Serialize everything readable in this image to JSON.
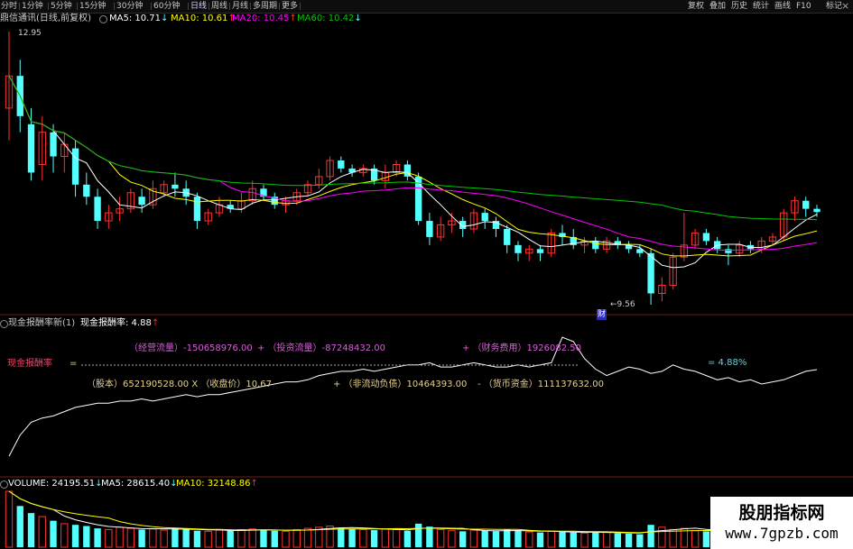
{
  "toolbar": {
    "periods": [
      "分时",
      "1分钟",
      "5分钟",
      "15分钟",
      "30分钟",
      "60分钟",
      "日线",
      "周线",
      "月线",
      "多周期",
      "更多"
    ],
    "active_period": "日线",
    "right_buttons": [
      "复权",
      "叠加",
      "历史",
      "统计",
      "画线",
      "F10",
      "标记"
    ],
    "close_icon": "×"
  },
  "header": {
    "stock": "鼎信通讯(日线,前复权)",
    "ma5": "MA5: 10.71",
    "ma5_arrow": "↓",
    "ma10": "MA10: 10.61",
    "ma10_arrow": "↑",
    "ma20": "MA20: 10.45",
    "ma20_arrow": "↑",
    "ma60": "MA60: 10.42",
    "ma60_arrow": "↓"
  },
  "price_labels": {
    "high": "12.95",
    "low": "9.56",
    "badge": "财"
  },
  "indicator": {
    "title": "现金报酬率新(1)",
    "value_label": "现金报酬率: 4.88",
    "value_arrow": "↑",
    "left_label": "现金报酬率",
    "eq": "=",
    "line1_a": "（经营流量）-150658976.00",
    "line1_b": "+ （投资流量）-87248432.00",
    "line1_c": "+ （财务费用）1926082.50",
    "pct_label": "= 4.88%",
    "line2_a": "（股本）652190528.00 X （收盘价）10.67",
    "line2_b": "+ （非流动负债）10464393.00",
    "line2_c": "- （货币资金）111137632.00"
  },
  "volume": {
    "label": "VOLUME: 24195.51",
    "label_arrow": "↓",
    "ma5": "MA5: 28615.40",
    "ma5_arrow": "↓",
    "ma10": "MA10: 32148.86",
    "ma10_arrow": "↑"
  },
  "watermark": {
    "title": "股朋指标网",
    "url": "www.7gpzb.com"
  },
  "colors": {
    "up": "#ff3232",
    "down": "#54ffff",
    "ma5": "#ffffff",
    "ma10": "#ffff00",
    "ma20": "#ff00ff",
    "ma60": "#00c800",
    "ratio_line": "#ffffff",
    "formula_magenta": "#d75fd7",
    "formula_yellow": "#e6d28c",
    "pct_cyan": "#6ecbd6"
  },
  "chart_data": [
    {
      "type": "candlestick",
      "title": "鼎信通讯(日线,前复权)",
      "y_extremes": {
        "high": 12.95,
        "low": 9.56
      },
      "series": [
        {
          "name": "MA5",
          "values": [
            10.71
          ]
        },
        {
          "name": "MA10",
          "values": [
            10.61
          ]
        },
        {
          "name": "MA20",
          "values": [
            10.45
          ]
        },
        {
          "name": "MA60",
          "values": [
            10.42
          ]
        }
      ],
      "candles": [
        [
          12.0,
          12.4,
          11.6,
          12.95
        ],
        [
          12.4,
          11.9,
          11.7,
          12.6
        ],
        [
          11.8,
          11.2,
          11.1,
          12.0
        ],
        [
          11.3,
          11.7,
          11.1,
          11.9
        ],
        [
          11.7,
          11.4,
          11.2,
          11.8
        ],
        [
          11.4,
          11.55,
          11.2,
          11.7
        ],
        [
          11.5,
          11.05,
          10.9,
          11.6
        ],
        [
          11.05,
          10.9,
          10.8,
          11.2
        ],
        [
          10.9,
          10.6,
          10.5,
          11.0
        ],
        [
          10.6,
          10.7,
          10.5,
          10.8
        ],
        [
          10.7,
          10.75,
          10.6,
          10.9
        ],
        [
          10.75,
          10.95,
          10.7,
          11.0
        ],
        [
          10.9,
          10.8,
          10.7,
          11.0
        ],
        [
          10.8,
          11.0,
          10.75,
          11.1
        ],
        [
          10.95,
          11.05,
          10.9,
          11.1
        ],
        [
          11.05,
          11.0,
          10.9,
          11.2
        ],
        [
          11.0,
          10.9,
          10.8,
          11.1
        ],
        [
          10.9,
          10.6,
          10.5,
          10.95
        ],
        [
          10.6,
          10.7,
          10.55,
          10.75
        ],
        [
          10.7,
          10.8,
          10.65,
          10.9
        ],
        [
          10.8,
          10.75,
          10.7,
          10.85
        ],
        [
          10.75,
          10.85,
          10.7,
          10.95
        ],
        [
          10.85,
          11.0,
          10.8,
          11.1
        ],
        [
          11.0,
          10.9,
          10.85,
          11.05
        ],
        [
          10.9,
          10.8,
          10.75,
          10.95
        ],
        [
          10.8,
          10.85,
          10.7,
          10.9
        ],
        [
          10.85,
          10.95,
          10.8,
          11.0
        ],
        [
          10.95,
          11.05,
          10.9,
          11.1
        ],
        [
          11.05,
          11.15,
          11.0,
          11.25
        ],
        [
          11.15,
          11.35,
          11.1,
          11.4
        ],
        [
          11.35,
          11.25,
          11.2,
          11.4
        ],
        [
          11.25,
          11.2,
          11.15,
          11.3
        ],
        [
          11.2,
          11.25,
          11.15,
          11.3
        ],
        [
          11.25,
          11.1,
          11.05,
          11.3
        ],
        [
          11.1,
          11.2,
          11.0,
          11.3
        ],
        [
          11.2,
          11.3,
          11.15,
          11.35
        ],
        [
          11.3,
          11.15,
          11.1,
          11.35
        ],
        [
          11.15,
          10.6,
          10.55,
          11.2
        ],
        [
          10.6,
          10.4,
          10.3,
          10.7
        ],
        [
          10.4,
          10.55,
          10.35,
          10.65
        ],
        [
          10.55,
          10.6,
          10.45,
          10.7
        ],
        [
          10.6,
          10.5,
          10.4,
          10.65
        ],
        [
          10.5,
          10.7,
          10.45,
          10.75
        ],
        [
          10.7,
          10.6,
          10.5,
          10.75
        ],
        [
          10.6,
          10.5,
          10.4,
          10.65
        ],
        [
          10.5,
          10.3,
          10.2,
          10.55
        ],
        [
          10.3,
          10.2,
          10.1,
          10.35
        ],
        [
          10.2,
          10.25,
          10.1,
          10.3
        ],
        [
          10.25,
          10.2,
          10.1,
          10.3
        ],
        [
          10.2,
          10.45,
          10.15,
          10.5
        ],
        [
          10.45,
          10.4,
          10.3,
          10.55
        ],
        [
          10.4,
          10.3,
          10.25,
          10.5
        ],
        [
          10.3,
          10.35,
          10.2,
          10.4
        ],
        [
          10.35,
          10.25,
          10.2,
          10.4
        ],
        [
          10.25,
          10.35,
          10.2,
          10.4
        ],
        [
          10.35,
          10.3,
          10.25,
          10.4
        ],
        [
          10.3,
          10.25,
          10.2,
          10.35
        ],
        [
          10.25,
          10.2,
          10.15,
          10.3
        ],
        [
          10.2,
          9.7,
          9.56,
          10.25
        ],
        [
          9.7,
          9.8,
          9.6,
          9.9
        ],
        [
          9.8,
          10.15,
          9.75,
          10.2
        ],
        [
          10.15,
          10.3,
          10.1,
          10.7
        ],
        [
          10.3,
          10.45,
          10.25,
          10.5
        ],
        [
          10.45,
          10.35,
          10.3,
          10.5
        ],
        [
          10.35,
          10.25,
          10.2,
          10.4
        ],
        [
          10.25,
          10.2,
          10.05,
          10.3
        ],
        [
          10.2,
          10.3,
          10.15,
          10.35
        ],
        [
          10.3,
          10.25,
          10.2,
          10.35
        ],
        [
          10.25,
          10.35,
          10.2,
          10.4
        ],
        [
          10.35,
          10.4,
          10.3,
          10.45
        ],
        [
          10.4,
          10.7,
          10.35,
          10.75
        ],
        [
          10.7,
          10.85,
          10.6,
          10.9
        ],
        [
          10.85,
          10.75,
          10.65,
          10.9
        ],
        [
          10.75,
          10.71,
          10.65,
          10.8
        ]
      ]
    },
    {
      "type": "line",
      "title": "现金报酬率新(1)",
      "series": [
        {
          "name": "现金报酬率",
          "values": [
            0.8,
            1.8,
            2.4,
            2.6,
            2.7,
            2.9,
            3.1,
            3.2,
            3.3,
            3.3,
            3.4,
            3.4,
            3.5,
            3.4,
            3.5,
            3.6,
            3.7,
            3.6,
            3.7,
            3.7,
            3.8,
            3.9,
            4.0,
            4.1,
            4.2,
            4.3,
            4.3,
            4.4,
            4.6,
            4.7,
            4.8,
            4.8,
            4.9,
            4.8,
            4.9,
            5.0,
            5.1,
            5.1,
            5.2,
            5.0,
            5.0,
            5.1,
            5.2,
            5.1,
            5.0,
            5.0,
            5.1,
            5.0,
            5.1,
            5.2,
            6.4,
            6.2,
            5.4,
            4.9,
            4.6,
            4.8,
            5.0,
            4.9,
            4.7,
            4.8,
            5.1,
            4.9,
            4.8,
            4.6,
            4.4,
            4.5,
            4.3,
            4.4,
            4.2,
            4.3,
            4.4,
            4.6,
            4.8,
            4.88
          ]
        }
      ]
    },
    {
      "type": "bar",
      "title": "VOLUME",
      "series": [
        {
          "name": "VOLUME",
          "values": [
            95000,
            70000,
            58000,
            52000,
            45000,
            40000,
            38000,
            36000,
            32000,
            30000,
            34000,
            32000,
            30000,
            31000,
            29000,
            33000,
            30000,
            28000,
            27000,
            29000,
            28000,
            30000,
            31000,
            29000,
            28000,
            27000,
            30000,
            32000,
            34000,
            36000,
            33000,
            31000,
            30000,
            29000,
            31000,
            30000,
            28000,
            40000,
            35000,
            30000,
            28000,
            27000,
            29000,
            28000,
            27000,
            30000,
            28000,
            26000,
            25000,
            27000,
            26000,
            25000,
            24000,
            25000,
            26000,
            24000,
            23000,
            22000,
            38000,
            34000,
            30000,
            32000,
            28000,
            27000,
            26000,
            25000,
            24000,
            25000,
            23000,
            24000,
            30000,
            28000,
            26000,
            24195.51
          ]
        },
        {
          "name": "MA5",
          "values": [
            28615.4
          ]
        },
        {
          "name": "MA10",
          "values": [
            32148.86
          ]
        }
      ]
    }
  ]
}
